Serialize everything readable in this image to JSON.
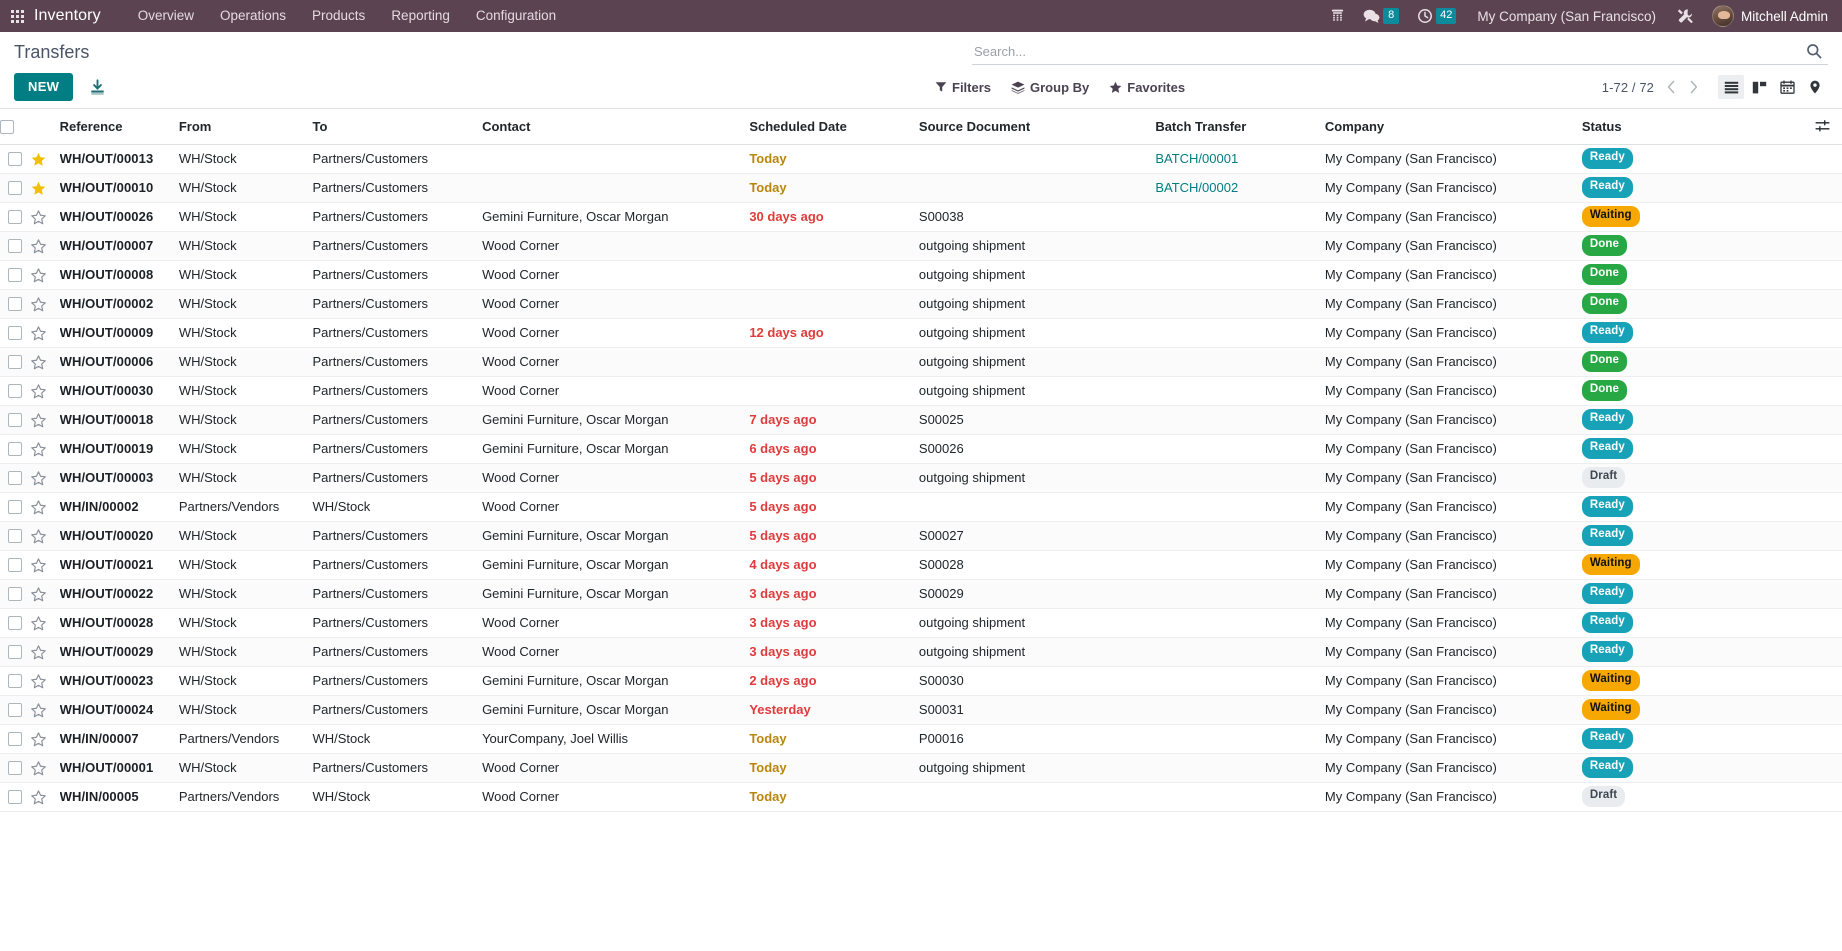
{
  "navbar": {
    "apps_icon": "apps-grid-icon",
    "brand": "Inventory",
    "menus": [
      "Overview",
      "Operations",
      "Products",
      "Reporting",
      "Configuration"
    ],
    "systray": {
      "phone_icon": "ip-phone-icon",
      "messages_icon": "messages-icon",
      "messages_count": "8",
      "activities_icon": "activities-clock-icon",
      "activities_count": "42",
      "company": "My Company (San Francisco)",
      "debug_icon": "debug-tools-icon",
      "user": "Mitchell Admin"
    }
  },
  "control_panel": {
    "title": "Transfers",
    "new_label": "NEW",
    "export_icon": "export-download-icon",
    "search": {
      "placeholder": "Search...",
      "value": "",
      "icon": "search-icon"
    },
    "filters": [
      {
        "label": "Filters",
        "icon": "filter-funnel-icon"
      },
      {
        "label": "Group By",
        "icon": "layers-icon"
      },
      {
        "label": "Favorites",
        "icon": "star-icon"
      }
    ],
    "pager": {
      "range": "1-72 / 72",
      "previous_icon": "chevron-left-icon",
      "next_icon": "chevron-right-icon"
    },
    "views": [
      {
        "name": "list",
        "icon": "list-view-icon",
        "active": true
      },
      {
        "name": "kanban",
        "icon": "kanban-view-icon",
        "active": false
      },
      {
        "name": "calendar",
        "icon": "calendar-view-icon",
        "active": false
      },
      {
        "name": "map",
        "icon": "map-pin-view-icon",
        "active": false
      }
    ]
  },
  "table": {
    "columns": [
      "Reference",
      "From",
      "To",
      "Contact",
      "Scheduled Date",
      "Source Document",
      "Batch Transfer",
      "Company",
      "Status"
    ],
    "optional_columns_icon": "sliders-icon",
    "select_all_checkbox": false,
    "rows": [
      {
        "starred": true,
        "reference": "WH/OUT/00013",
        "from": "WH/Stock",
        "to": "Partners/Customers",
        "contact": "",
        "scheduled": "Today",
        "date_style": "today",
        "source": "",
        "batch": "BATCH/00001",
        "company": "My Company (San Francisco)",
        "status": "Ready",
        "status_style": "ready"
      },
      {
        "starred": true,
        "reference": "WH/OUT/00010",
        "from": "WH/Stock",
        "to": "Partners/Customers",
        "contact": "",
        "scheduled": "Today",
        "date_style": "today",
        "source": "",
        "batch": "BATCH/00002",
        "company": "My Company (San Francisco)",
        "status": "Ready",
        "status_style": "ready"
      },
      {
        "starred": false,
        "reference": "WH/OUT/00026",
        "from": "WH/Stock",
        "to": "Partners/Customers",
        "contact": "Gemini Furniture, Oscar Morgan",
        "scheduled": "30 days ago",
        "date_style": "late",
        "source": "S00038",
        "batch": "",
        "company": "My Company (San Francisco)",
        "status": "Waiting",
        "status_style": "waiting"
      },
      {
        "starred": false,
        "reference": "WH/OUT/00007",
        "from": "WH/Stock",
        "to": "Partners/Customers",
        "contact": "Wood Corner",
        "scheduled": "",
        "date_style": "plain",
        "source": "outgoing shipment",
        "batch": "",
        "company": "My Company (San Francisco)",
        "status": "Done",
        "status_style": "done"
      },
      {
        "starred": false,
        "reference": "WH/OUT/00008",
        "from": "WH/Stock",
        "to": "Partners/Customers",
        "contact": "Wood Corner",
        "scheduled": "",
        "date_style": "plain",
        "source": "outgoing shipment",
        "batch": "",
        "company": "My Company (San Francisco)",
        "status": "Done",
        "status_style": "done"
      },
      {
        "starred": false,
        "reference": "WH/OUT/00002",
        "from": "WH/Stock",
        "to": "Partners/Customers",
        "contact": "Wood Corner",
        "scheduled": "",
        "date_style": "plain",
        "source": "outgoing shipment",
        "batch": "",
        "company": "My Company (San Francisco)",
        "status": "Done",
        "status_style": "done"
      },
      {
        "starred": false,
        "reference": "WH/OUT/00009",
        "from": "WH/Stock",
        "to": "Partners/Customers",
        "contact": "Wood Corner",
        "scheduled": "12 days ago",
        "date_style": "late",
        "source": "outgoing shipment",
        "batch": "",
        "company": "My Company (San Francisco)",
        "status": "Ready",
        "status_style": "ready"
      },
      {
        "starred": false,
        "reference": "WH/OUT/00006",
        "from": "WH/Stock",
        "to": "Partners/Customers",
        "contact": "Wood Corner",
        "scheduled": "",
        "date_style": "plain",
        "source": "outgoing shipment",
        "batch": "",
        "company": "My Company (San Francisco)",
        "status": "Done",
        "status_style": "done"
      },
      {
        "starred": false,
        "reference": "WH/OUT/00030",
        "from": "WH/Stock",
        "to": "Partners/Customers",
        "contact": "Wood Corner",
        "scheduled": "",
        "date_style": "plain",
        "source": "outgoing shipment",
        "batch": "",
        "company": "My Company (San Francisco)",
        "status": "Done",
        "status_style": "done"
      },
      {
        "starred": false,
        "reference": "WH/OUT/00018",
        "from": "WH/Stock",
        "to": "Partners/Customers",
        "contact": "Gemini Furniture, Oscar Morgan",
        "scheduled": "7 days ago",
        "date_style": "late",
        "source": "S00025",
        "batch": "",
        "company": "My Company (San Francisco)",
        "status": "Ready",
        "status_style": "ready"
      },
      {
        "starred": false,
        "reference": "WH/OUT/00019",
        "from": "WH/Stock",
        "to": "Partners/Customers",
        "contact": "Gemini Furniture, Oscar Morgan",
        "scheduled": "6 days ago",
        "date_style": "late",
        "source": "S00026",
        "batch": "",
        "company": "My Company (San Francisco)",
        "status": "Ready",
        "status_style": "ready"
      },
      {
        "starred": false,
        "reference": "WH/OUT/00003",
        "from": "WH/Stock",
        "to": "Partners/Customers",
        "contact": "Wood Corner",
        "scheduled": "5 days ago",
        "date_style": "late",
        "source": "outgoing shipment",
        "batch": "",
        "company": "My Company (San Francisco)",
        "status": "Draft",
        "status_style": "draft"
      },
      {
        "starred": false,
        "reference": "WH/IN/00002",
        "from": "Partners/Vendors",
        "to": "WH/Stock",
        "contact": "Wood Corner",
        "scheduled": "5 days ago",
        "date_style": "late",
        "source": "",
        "batch": "",
        "company": "My Company (San Francisco)",
        "status": "Ready",
        "status_style": "ready"
      },
      {
        "starred": false,
        "reference": "WH/OUT/00020",
        "from": "WH/Stock",
        "to": "Partners/Customers",
        "contact": "Gemini Furniture, Oscar Morgan",
        "scheduled": "5 days ago",
        "date_style": "late",
        "source": "S00027",
        "batch": "",
        "company": "My Company (San Francisco)",
        "status": "Ready",
        "status_style": "ready"
      },
      {
        "starred": false,
        "reference": "WH/OUT/00021",
        "from": "WH/Stock",
        "to": "Partners/Customers",
        "contact": "Gemini Furniture, Oscar Morgan",
        "scheduled": "4 days ago",
        "date_style": "late",
        "source": "S00028",
        "batch": "",
        "company": "My Company (San Francisco)",
        "status": "Waiting",
        "status_style": "waiting"
      },
      {
        "starred": false,
        "reference": "WH/OUT/00022",
        "from": "WH/Stock",
        "to": "Partners/Customers",
        "contact": "Gemini Furniture, Oscar Morgan",
        "scheduled": "3 days ago",
        "date_style": "late",
        "source": "S00029",
        "batch": "",
        "company": "My Company (San Francisco)",
        "status": "Ready",
        "status_style": "ready"
      },
      {
        "starred": false,
        "reference": "WH/OUT/00028",
        "from": "WH/Stock",
        "to": "Partners/Customers",
        "contact": "Wood Corner",
        "scheduled": "3 days ago",
        "date_style": "late",
        "source": "outgoing shipment",
        "batch": "",
        "company": "My Company (San Francisco)",
        "status": "Ready",
        "status_style": "ready"
      },
      {
        "starred": false,
        "reference": "WH/OUT/00029",
        "from": "WH/Stock",
        "to": "Partners/Customers",
        "contact": "Wood Corner",
        "scheduled": "3 days ago",
        "date_style": "late",
        "source": "outgoing shipment",
        "batch": "",
        "company": "My Company (San Francisco)",
        "status": "Ready",
        "status_style": "ready"
      },
      {
        "starred": false,
        "reference": "WH/OUT/00023",
        "from": "WH/Stock",
        "to": "Partners/Customers",
        "contact": "Gemini Furniture, Oscar Morgan",
        "scheduled": "2 days ago",
        "date_style": "late",
        "source": "S00030",
        "batch": "",
        "company": "My Company (San Francisco)",
        "status": "Waiting",
        "status_style": "waiting"
      },
      {
        "starred": false,
        "reference": "WH/OUT/00024",
        "from": "WH/Stock",
        "to": "Partners/Customers",
        "contact": "Gemini Furniture, Oscar Morgan",
        "scheduled": "Yesterday",
        "date_style": "late",
        "source": "S00031",
        "batch": "",
        "company": "My Company (San Francisco)",
        "status": "Waiting",
        "status_style": "waiting"
      },
      {
        "starred": false,
        "reference": "WH/IN/00007",
        "from": "Partners/Vendors",
        "to": "WH/Stock",
        "contact": "YourCompany, Joel Willis",
        "scheduled": "Today",
        "date_style": "today",
        "source": "P00016",
        "batch": "",
        "company": "My Company (San Francisco)",
        "status": "Ready",
        "status_style": "ready"
      },
      {
        "starred": false,
        "reference": "WH/OUT/00001",
        "from": "WH/Stock",
        "to": "Partners/Customers",
        "contact": "Wood Corner",
        "scheduled": "Today",
        "date_style": "today",
        "source": "outgoing shipment",
        "batch": "",
        "company": "My Company (San Francisco)",
        "status": "Ready",
        "status_style": "ready"
      },
      {
        "starred": false,
        "reference": "WH/IN/00005",
        "from": "Partners/Vendors",
        "to": "WH/Stock",
        "contact": "Wood Corner",
        "scheduled": "Today",
        "date_style": "today",
        "source": "",
        "batch": "",
        "company": "My Company (San Francisco)",
        "status": "Draft",
        "status_style": "draft"
      }
    ]
  },
  "colors": {
    "navbar_bg": "#5c4352",
    "accent": "#017e84",
    "ready": "#17a2b8",
    "waiting": "#f6a800",
    "done": "#28a745",
    "draft": "#e9ecef",
    "today_text": "#b8860b",
    "late_text": "#e03b3b"
  }
}
